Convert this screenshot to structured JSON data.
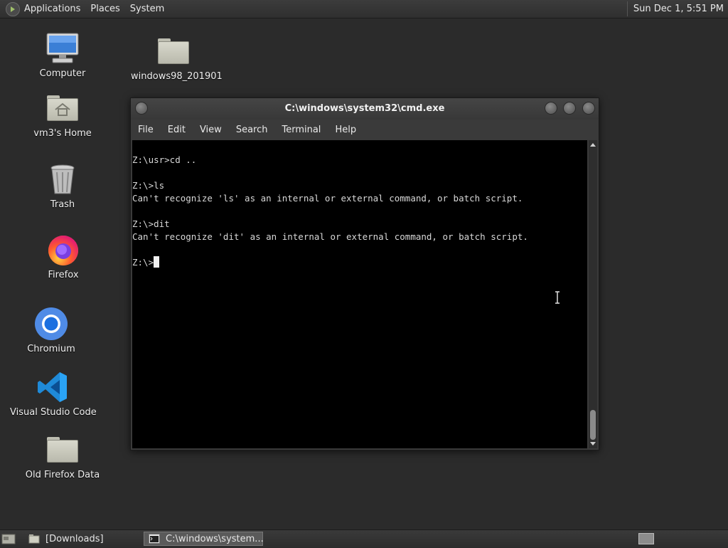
{
  "top_panel": {
    "menus": [
      "Applications",
      "Places",
      "System"
    ],
    "clock": "Sun Dec 1,  5:51 PM"
  },
  "desktop_icons": {
    "computer": "Computer",
    "home": "vm3's Home",
    "trash": "Trash",
    "firefox": "Firefox",
    "chromium": "Chromium",
    "vscode": "Visual Studio Code",
    "old_firefox": "Old Firefox Data",
    "windows98": "windows98_201901"
  },
  "window": {
    "title": "C:\\windows\\system32\\cmd.exe",
    "menu": [
      "File",
      "Edit",
      "View",
      "Search",
      "Terminal",
      "Help"
    ],
    "terminal_lines": [
      "Z:\\usr>cd ..",
      "",
      "Z:\\>ls",
      "Can't recognize 'ls' as an internal or external command, or batch script.",
      "",
      "Z:\\>dit",
      "Can't recognize 'dit' as an internal or external command, or batch script.",
      "",
      "Z:\\>"
    ]
  },
  "taskbar": {
    "items": [
      "[Downloads]",
      "C:\\windows\\system..."
    ]
  },
  "colors": {
    "desktop_bg": "#2b2b2b",
    "terminal_bg": "#000000",
    "terminal_fg": "#d8d8d8"
  }
}
